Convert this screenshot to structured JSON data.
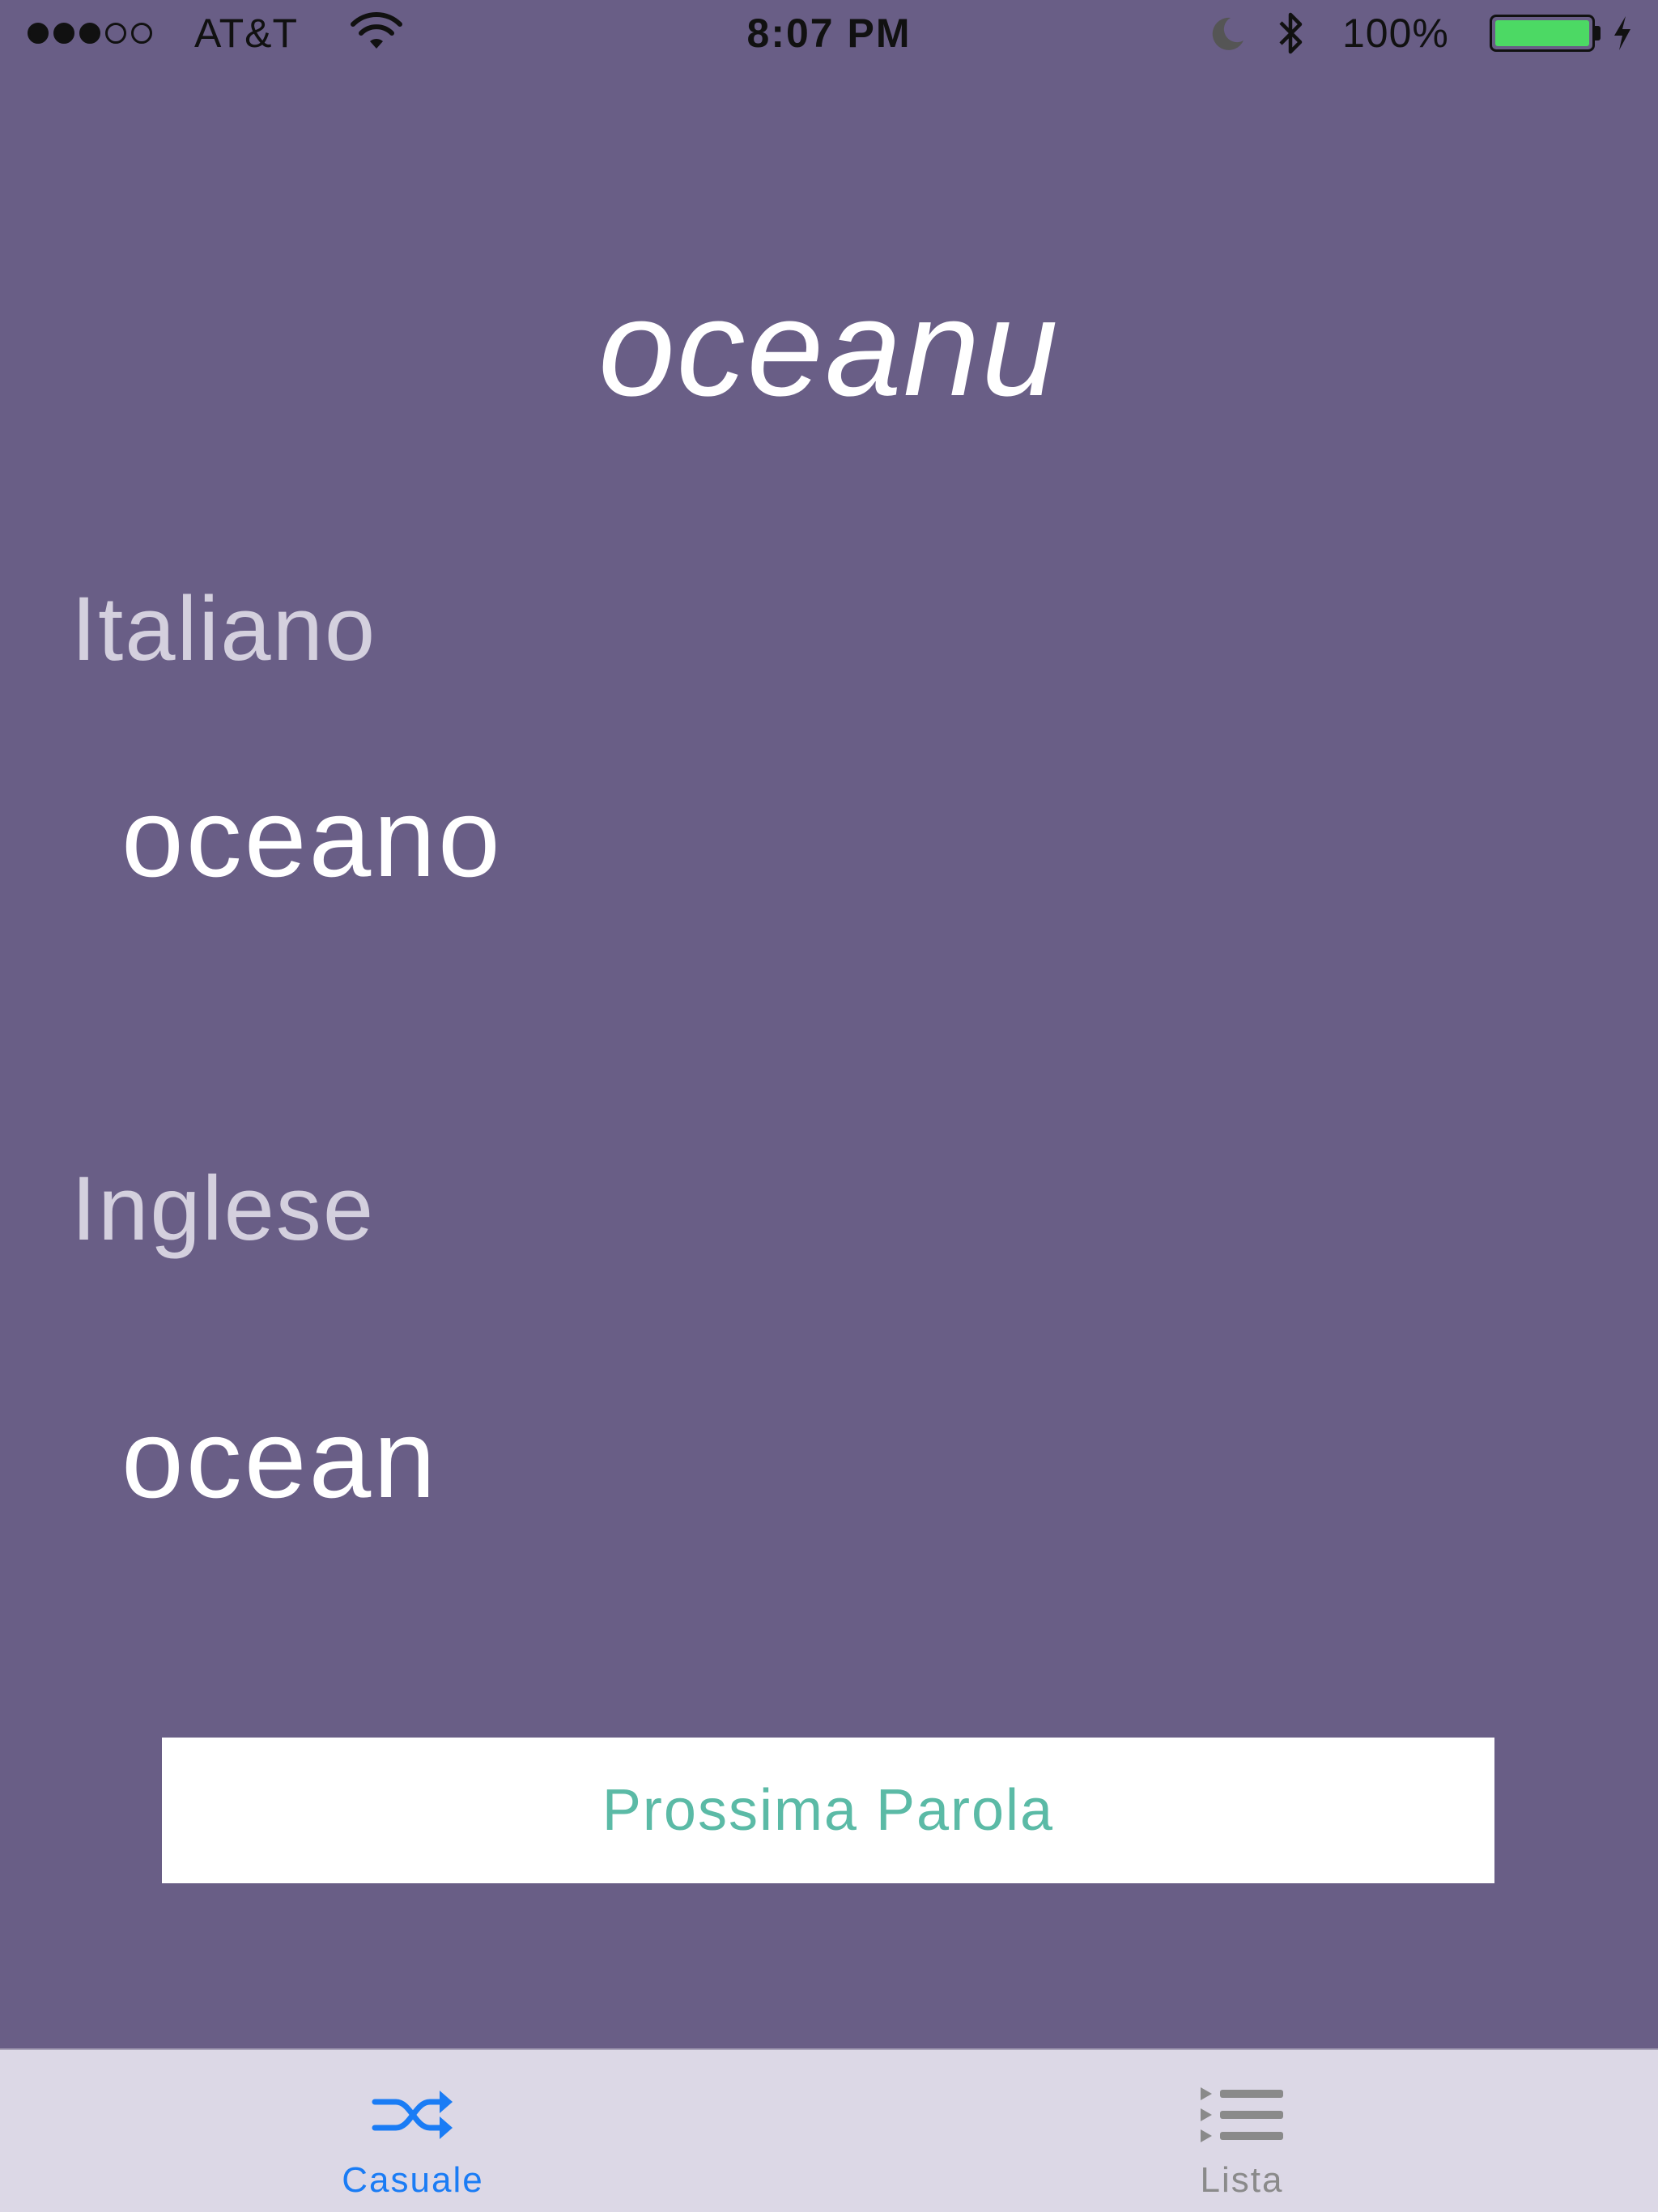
{
  "status_bar": {
    "carrier": "AT&T",
    "time": "8:07 PM",
    "battery_percent": "100%",
    "battery_level": 1.0,
    "signal_bars_filled": 3,
    "signal_bars_total": 5,
    "battery_color": "#4cd964"
  },
  "card": {
    "dialect_word": "oceanu",
    "italian_label": "Italiano",
    "italian_value": "oceano",
    "english_label": "Inglese",
    "english_value": "ocean"
  },
  "next_button": {
    "label": "Prossima Parola"
  },
  "tab_bar": {
    "tabs": [
      {
        "label": "Casuale",
        "icon": "shuffle-icon",
        "selected": true
      },
      {
        "label": "Lista",
        "icon": "list-icon",
        "selected": false
      }
    ]
  },
  "colors": {
    "background": "#695e86",
    "accent": "#1a7cf5",
    "button_text": "#5bbaa6"
  }
}
